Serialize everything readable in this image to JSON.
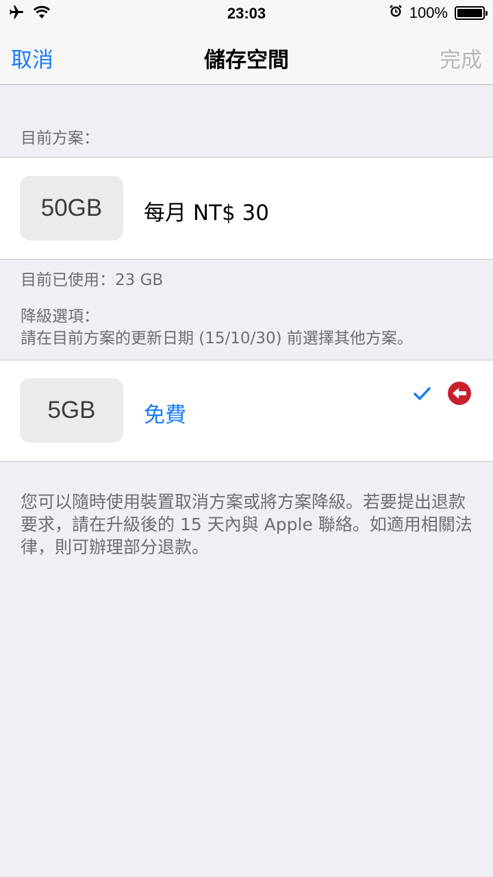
{
  "status_bar": {
    "time": "23:03",
    "battery_percent": "100%",
    "battery_level": 1.0,
    "icons": [
      "airplane-icon",
      "wifi-icon",
      "alarm-icon",
      "battery-icon"
    ]
  },
  "nav": {
    "cancel_label": "取消",
    "title": "儲存空間",
    "done_label": "完成"
  },
  "current_plan": {
    "header": "目前方案：",
    "size": "50GB",
    "price": "每月 NT$ 30"
  },
  "usage": {
    "used_text": "目前已使用：23 GB"
  },
  "downgrade": {
    "header": "降級選項：",
    "instruction": "請在目前方案的更新日期 (15/10/30) 前選擇其他方案。",
    "options": [
      {
        "size": "5GB",
        "price": "免費",
        "selected": true
      }
    ]
  },
  "footer": {
    "note": "您可以隨時使用裝置取消方案或將方案降級。若要提出退款要求，請在升級後的 15 天內與 Apple 聯絡。如適用相關法律，則可辦理部分退款。"
  },
  "colors": {
    "accent": "#1a7cf5",
    "disabled": "#b8b8bc",
    "background": "#efeff4",
    "downgrade_badge": "#c8202d"
  }
}
